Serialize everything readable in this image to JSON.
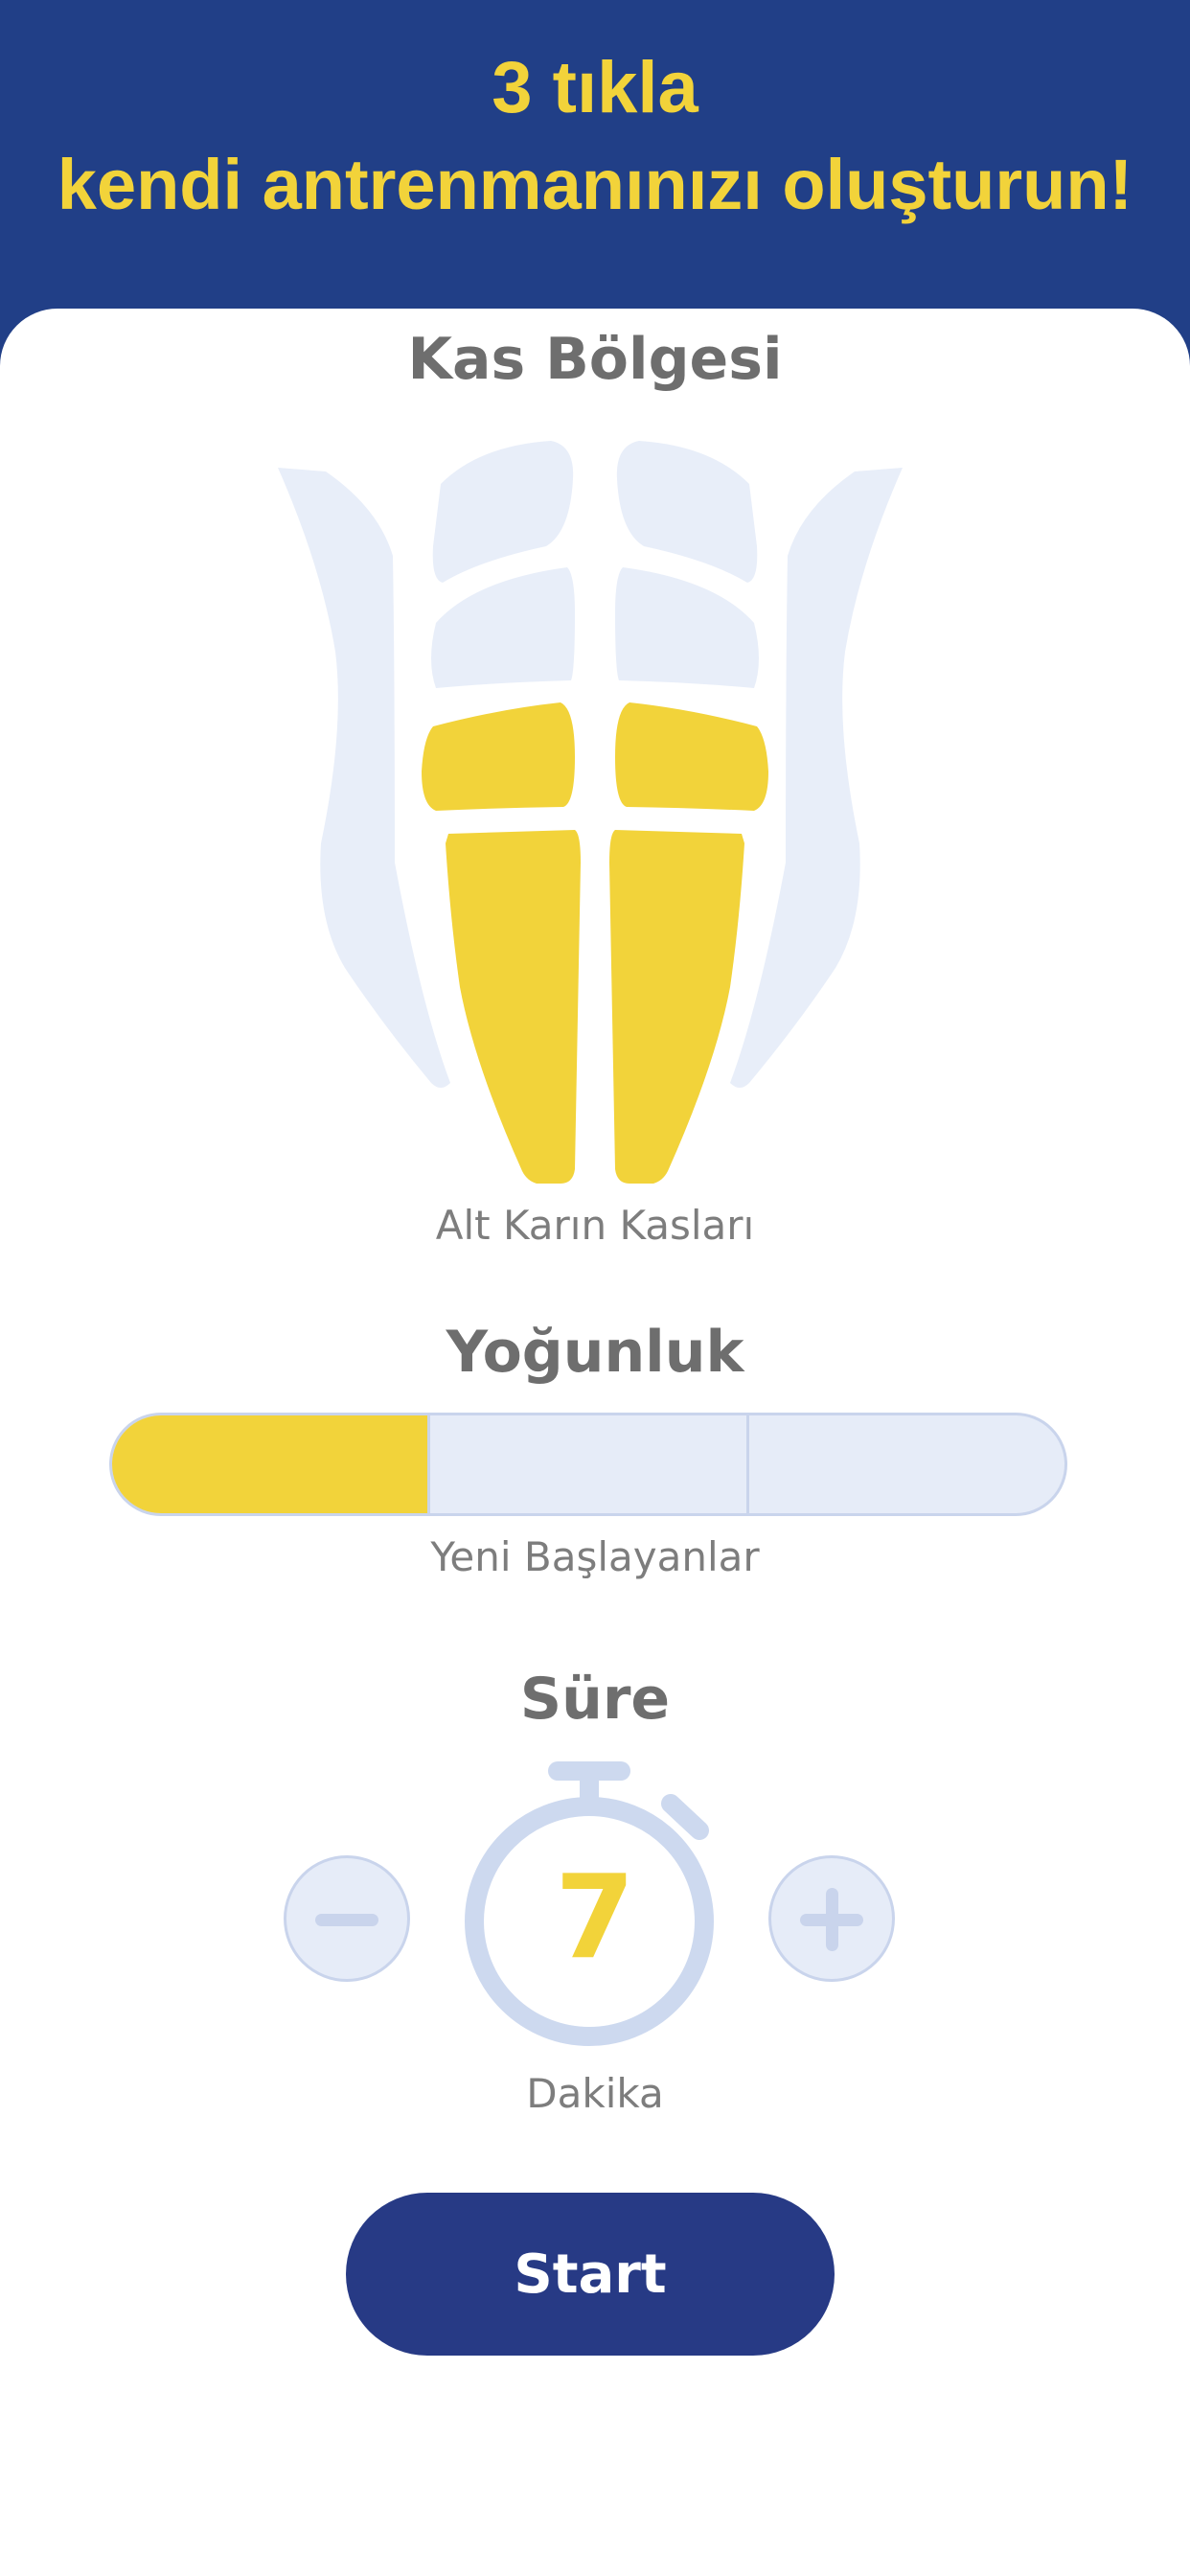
{
  "header": {
    "line1": "3 tıkla",
    "line2": "kendi antrenmanınızı oluşturun!"
  },
  "muscle": {
    "title": "Kas Bölgesi",
    "selected_label": "Alt Karın Kasları"
  },
  "intensity": {
    "title": "Yoğunluk",
    "levels_total": 3,
    "selected_level": 1,
    "selected_label": "Yeni Başlayanlar"
  },
  "duration": {
    "title": "Süre",
    "value": "7",
    "unit": "Dakika",
    "decrement_icon": "minus-icon",
    "increment_icon": "plus-icon"
  },
  "start_label": "Start",
  "colors": {
    "header_bg": "#213f87",
    "accent_yellow": "#f2d33a",
    "inactive_blue": "#e6ecf8",
    "outline_blue": "#c9d4ec",
    "button_bg": "#273a85",
    "text_gray": "#6e6e6e"
  }
}
